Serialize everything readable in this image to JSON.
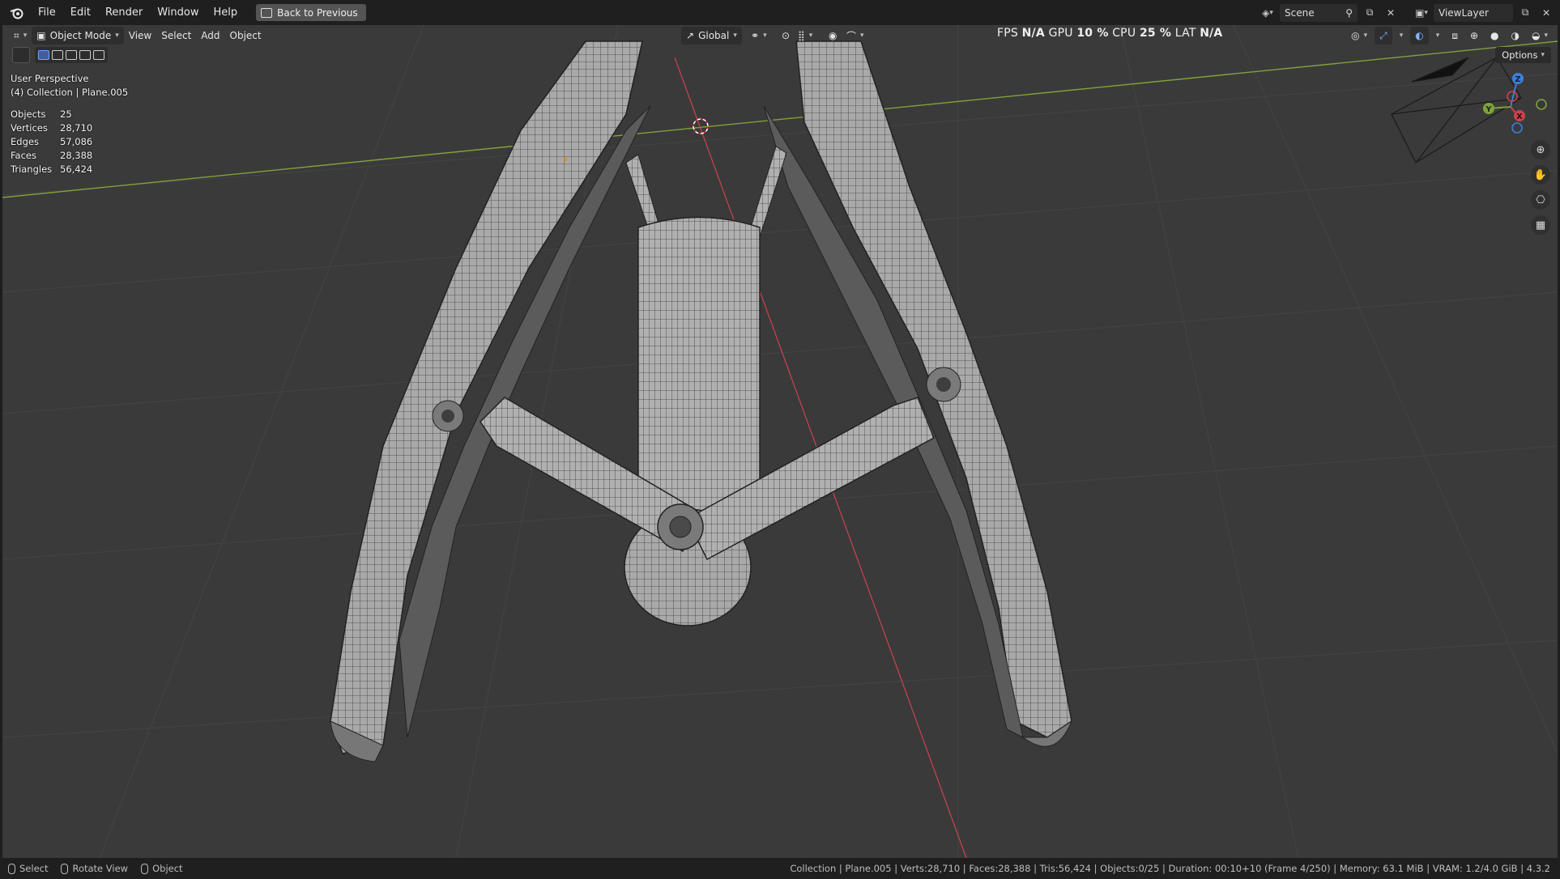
{
  "topbar": {
    "menu": [
      "File",
      "Edit",
      "Render",
      "Window",
      "Help"
    ],
    "back_button": "Back to Previous",
    "scene_name": "Scene",
    "view_layer": "ViewLayer"
  },
  "viewport_header": {
    "mode": "Object Mode",
    "menus": [
      "View",
      "Select",
      "Add",
      "Object"
    ],
    "orientation": "Global",
    "options": "Options"
  },
  "performance": {
    "fps_label": "FPS",
    "fps_value": "N/A",
    "gpu_label": "GPU",
    "gpu_value": "10 %",
    "cpu_label": "CPU",
    "cpu_value": "25 %",
    "lat_label": "LAT",
    "lat_value": "N/A"
  },
  "overlay": {
    "view_name": "User Perspective",
    "collection_line": "(4) Collection | Plane.005"
  },
  "stats": [
    {
      "label": "Objects",
      "value": "25"
    },
    {
      "label": "Vertices",
      "value": "28,710"
    },
    {
      "label": "Edges",
      "value": "57,086"
    },
    {
      "label": "Faces",
      "value": "28,388"
    },
    {
      "label": "Triangles",
      "value": "56,424"
    }
  ],
  "gizmo": {
    "x": "X",
    "y": "Y",
    "z": "Z"
  },
  "statusbar": {
    "select": "Select",
    "rotate": "Rotate View",
    "object": "Object",
    "info": "Collection | Plane.005 | Verts:28,710 | Faces:28,388 | Tris:56,424 | Objects:0/25 | Duration: 00:10+10 (Frame 4/250) | Memory: 63.1 MiB | VRAM: 1.2/4.0 GiB | 4.3.2"
  },
  "colors": {
    "x_axis": "#c9444d",
    "y_axis": "#7fa23c",
    "z_axis": "#3f7fd6",
    "viewport_bg": "#3a3a3a",
    "mesh": "#a8a8a8"
  }
}
